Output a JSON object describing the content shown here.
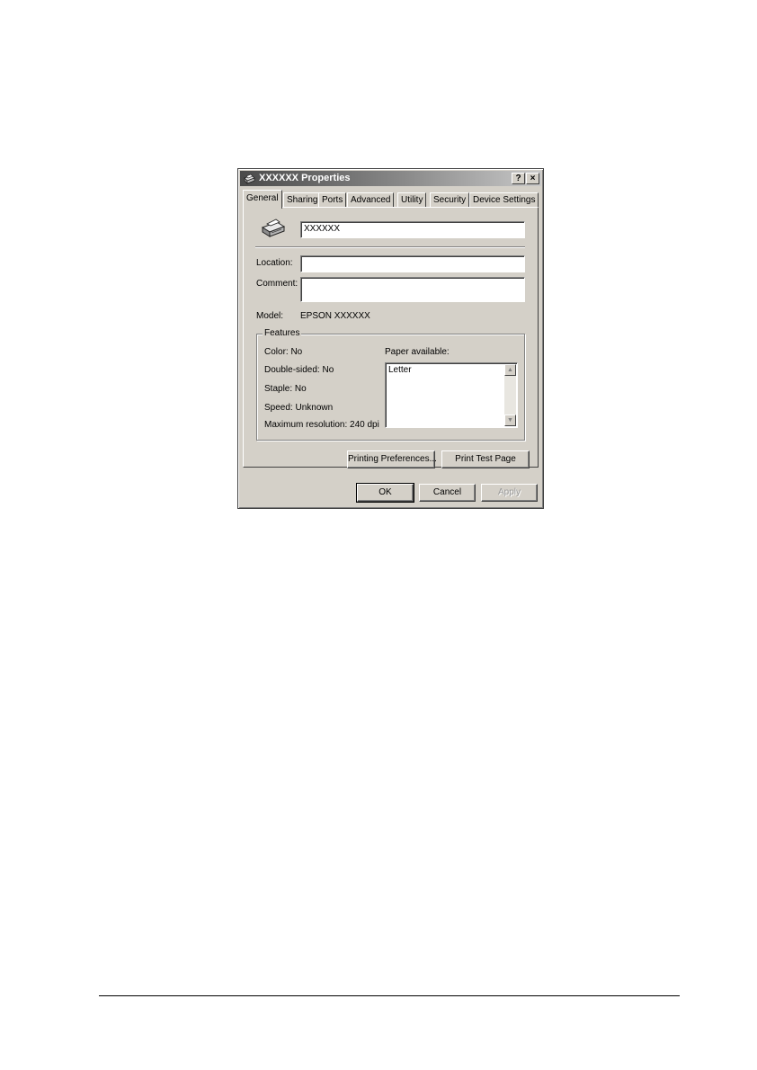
{
  "dialog": {
    "title": "XXXXXX Properties",
    "help_button": "?",
    "close_button": "×"
  },
  "tabs": [
    {
      "label": "General",
      "active": true
    },
    {
      "label": "Sharing",
      "active": false
    },
    {
      "label": "Ports",
      "active": false
    },
    {
      "label": "Advanced",
      "active": false
    },
    {
      "label": "Utility",
      "active": false
    },
    {
      "label": "Security",
      "active": false
    },
    {
      "label": "Device Settings",
      "active": false
    }
  ],
  "general": {
    "printer_name": "XXXXXX",
    "location_label": "Location:",
    "location_value": "",
    "comment_label": "Comment:",
    "comment_value": "",
    "model_label": "Model:",
    "model_value": "EPSON XXXXXX",
    "features": {
      "title": "Features",
      "color": "Color: No",
      "double_sided": "Double-sided: No",
      "staple": "Staple: No",
      "speed": "Speed: Unknown",
      "max_resolution": "Maximum resolution: 240 dpi",
      "paper_label": "Paper available:",
      "paper_items": [
        "Letter"
      ]
    },
    "printing_preferences_button": "Printing Preferences...",
    "print_test_page_button": "Print Test Page"
  },
  "footer_buttons": {
    "ok": "OK",
    "cancel": "Cancel",
    "apply": "Apply"
  }
}
